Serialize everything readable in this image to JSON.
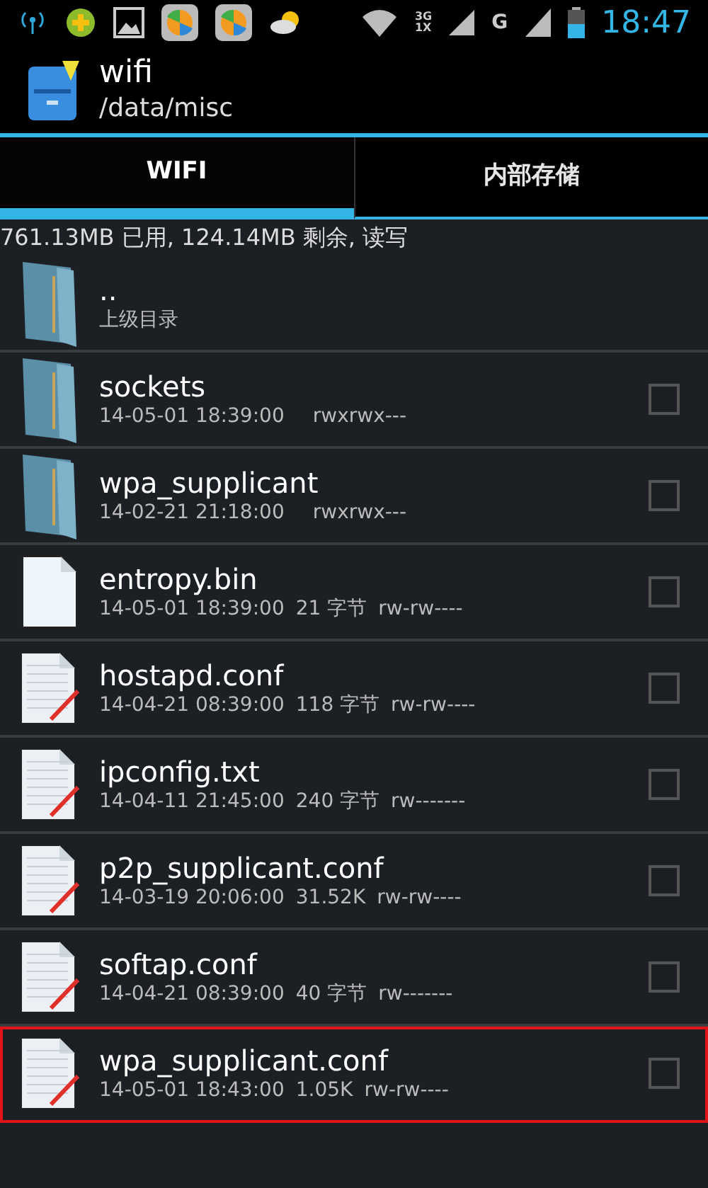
{
  "status_bar": {
    "network_types": [
      "3G",
      "1X"
    ],
    "signal_letter": "G",
    "time": "18:47"
  },
  "header": {
    "title": "wifi",
    "path": "/data/misc"
  },
  "tabs": [
    {
      "label": "WIFI",
      "selected": true
    },
    {
      "label": "内部存储",
      "selected": false
    }
  ],
  "storage_info": "761.13MB 已用, 124.14MB 剩余, 读写",
  "files": [
    {
      "kind": "folder",
      "name": "..",
      "detail": "上级目录",
      "highlighted": false
    },
    {
      "kind": "folder",
      "name": "sockets",
      "date": "14-05-01 18:39:00",
      "permissions": "rwxrwx---",
      "checked": false,
      "highlighted": false
    },
    {
      "kind": "folder",
      "name": "wpa_supplicant",
      "date": "14-02-21 21:18:00",
      "permissions": "rwxrwx---",
      "checked": false,
      "highlighted": false
    },
    {
      "kind": "file",
      "name": "entropy.bin",
      "date": "14-05-01 18:39:00",
      "size": "21 字节",
      "permissions": "rw-rw----",
      "checked": false,
      "highlighted": false
    },
    {
      "kind": "text",
      "name": "hostapd.conf",
      "date": "14-04-21 08:39:00",
      "size": "118 字节",
      "permissions": "rw-rw----",
      "checked": false,
      "highlighted": false
    },
    {
      "kind": "text",
      "name": "ipconfig.txt",
      "date": "14-04-11 21:45:00",
      "size": "240 字节",
      "permissions": "rw-------",
      "checked": false,
      "highlighted": false
    },
    {
      "kind": "text",
      "name": "p2p_supplicant.conf",
      "date": "14-03-19 20:06:00",
      "size": "31.52K",
      "permissions": "rw-rw----",
      "checked": false,
      "highlighted": false
    },
    {
      "kind": "text",
      "name": "softap.conf",
      "date": "14-04-21 08:39:00",
      "size": "40 字节",
      "permissions": "rw-------",
      "checked": false,
      "highlighted": false
    },
    {
      "kind": "text",
      "name": "wpa_supplicant.conf",
      "date": "14-05-01 18:43:00",
      "size": "1.05K",
      "permissions": "rw-rw----",
      "checked": false,
      "highlighted": true
    }
  ]
}
